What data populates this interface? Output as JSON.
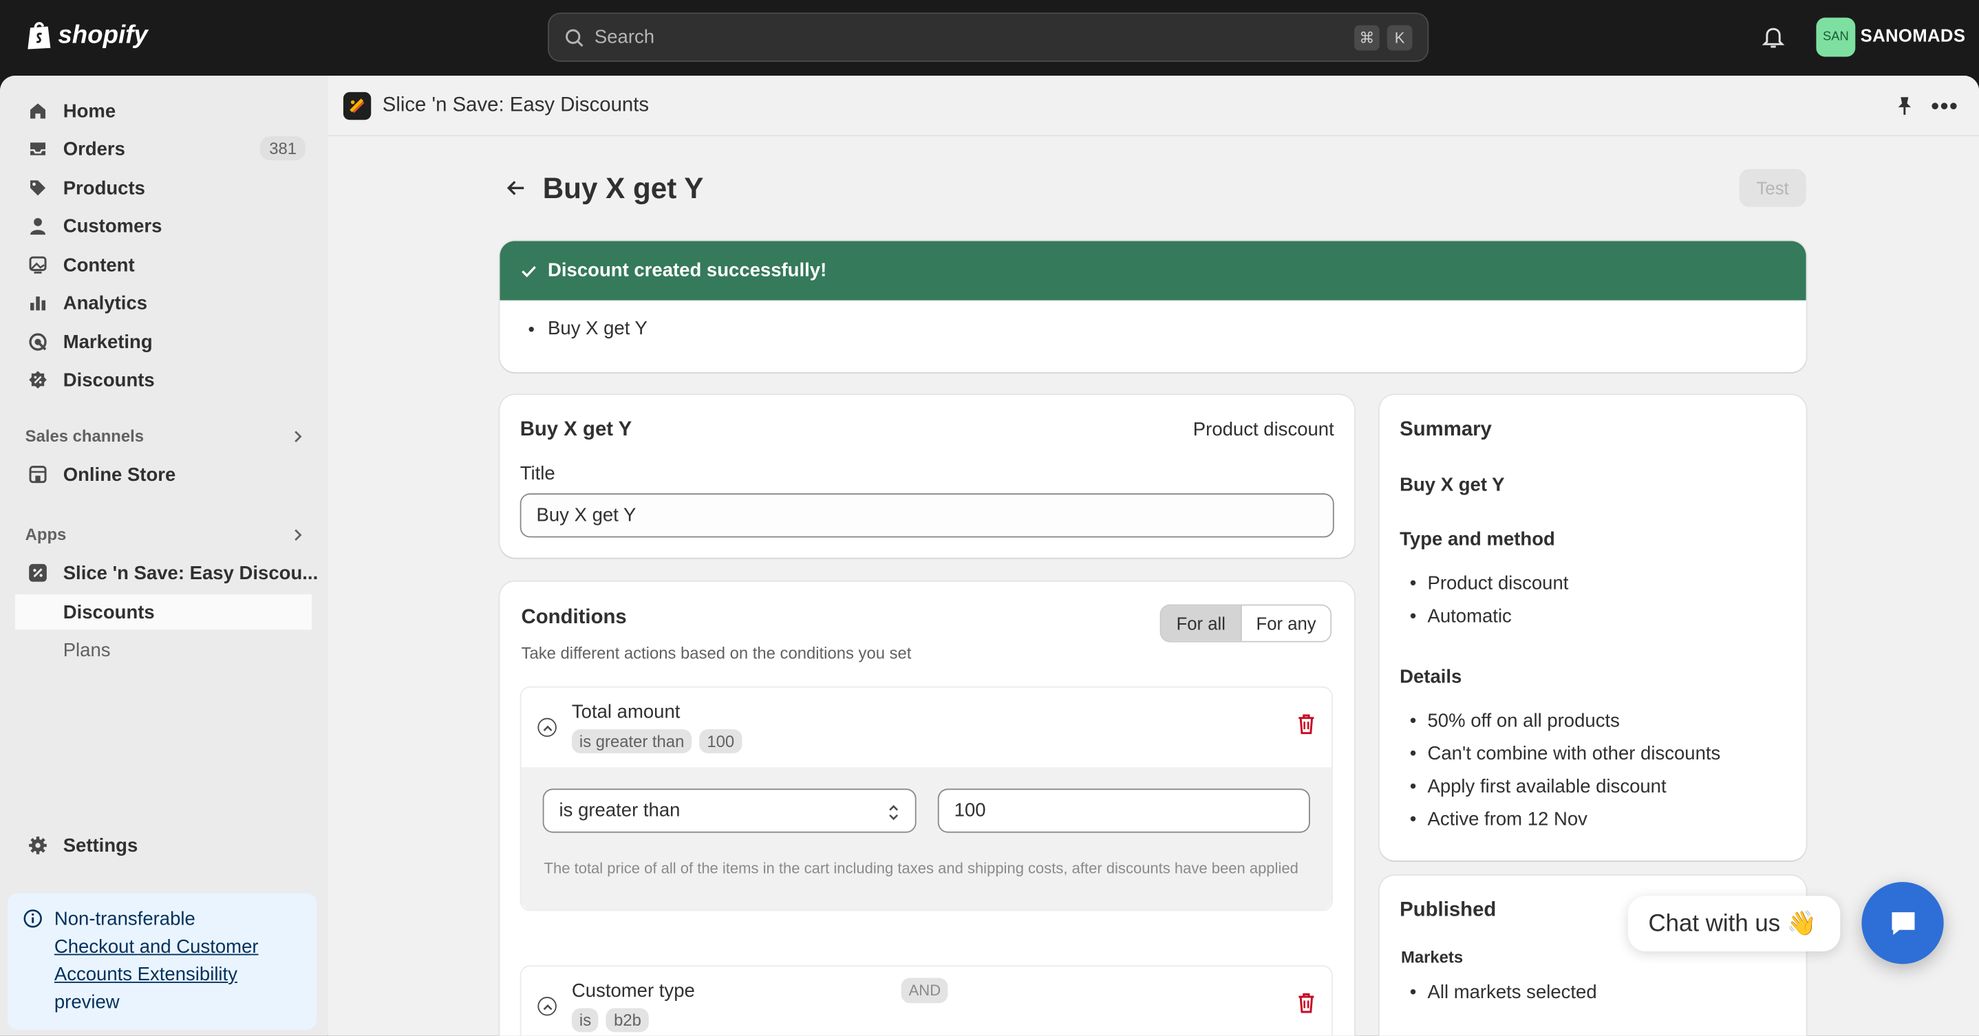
{
  "topbar": {
    "logo_text": "shopify",
    "search_placeholder": "Search",
    "shortcut_cmd": "⌘",
    "shortcut_key": "K",
    "avatar_initials": "SAN",
    "store_name": "SANOMADS"
  },
  "sidebar": {
    "items": [
      {
        "label": "Home",
        "icon": "home-icon"
      },
      {
        "label": "Orders",
        "icon": "inbox-icon",
        "count": "381"
      },
      {
        "label": "Products",
        "icon": "tag-icon"
      },
      {
        "label": "Customers",
        "icon": "person-icon"
      },
      {
        "label": "Content",
        "icon": "image-icon"
      },
      {
        "label": "Analytics",
        "icon": "bar-chart-icon"
      },
      {
        "label": "Marketing",
        "icon": "target-icon"
      },
      {
        "label": "Discounts",
        "icon": "discount-icon"
      }
    ],
    "sales_channels_heading": "Sales channels",
    "online_store": "Online Store",
    "apps_heading": "Apps",
    "app_name": "Slice 'n Save: Easy Discou...",
    "app_sub_discounts": "Discounts",
    "app_sub_plans": "Plans",
    "settings": "Settings",
    "banner": {
      "line1": "Non-transferable",
      "link": "Checkout and Customer Accounts Extensibility",
      "line3": "preview"
    }
  },
  "appbar": {
    "title": "Slice 'n Save: Easy Discounts"
  },
  "page": {
    "title": "Buy X get Y",
    "test_button": "Test",
    "success": {
      "heading": "Discount created successfully!",
      "items": [
        "Buy X get Y"
      ]
    },
    "details_card": {
      "heading": "Buy X get Y",
      "type": "Product discount",
      "title_label": "Title",
      "title_value": "Buy X get Y"
    },
    "conditions": {
      "heading": "Conditions",
      "subtitle": "Take different actions based on the conditions you set",
      "segment_all": "For all",
      "segment_any": "For any",
      "rule1": {
        "name": "Total amount",
        "chip_op": "is greater than",
        "chip_val": "100",
        "select_value": "is greater than",
        "value": "100",
        "help": "The total price of all of the items in the cart including taxes and shipping costs, after discounts have been applied"
      },
      "and_label": "AND",
      "rule2": {
        "name": "Customer type",
        "chip_op": "is",
        "chip_val": "b2b"
      }
    },
    "summary": {
      "heading": "Summary",
      "name": "Buy X get Y",
      "type_heading": "Type and method",
      "type_items": [
        "Product discount",
        "Automatic"
      ],
      "details_heading": "Details",
      "details_items": [
        "50% off on all products",
        "Can't combine with other discounts",
        "Apply first available discount",
        "Active from 12 Nov"
      ]
    },
    "published": {
      "heading": "Published",
      "markets_label": "Markets",
      "markets_value": "All markets selected"
    }
  },
  "chat": {
    "label": "Chat with us 👋"
  },
  "colors": {
    "success_green": "#357a5a",
    "chat_blue": "#2d6fd6",
    "delete_red": "#c70a24"
  }
}
